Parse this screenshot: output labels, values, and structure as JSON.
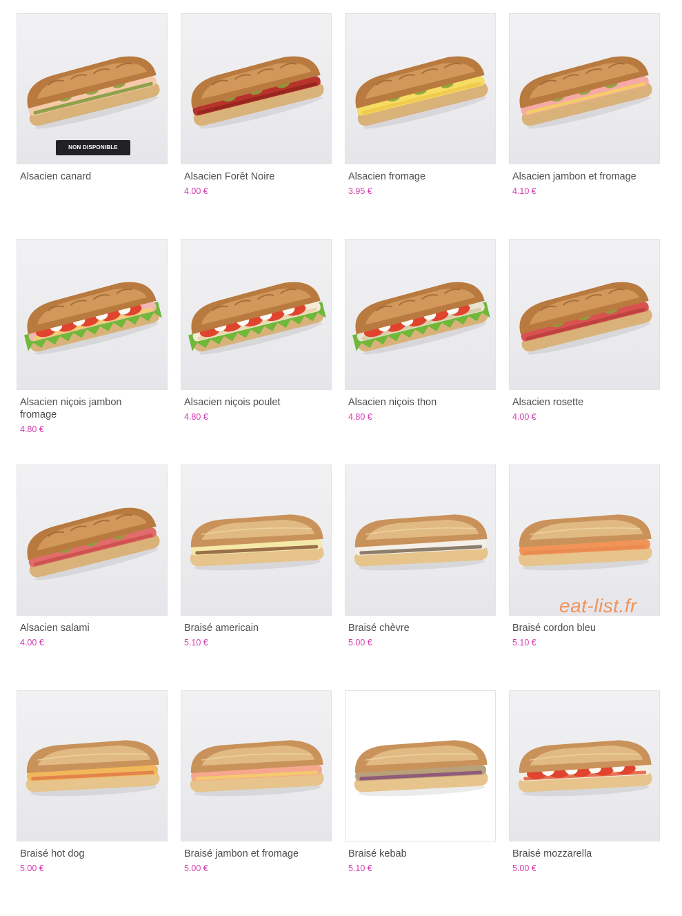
{
  "products": [
    {
      "name": "Alsacien canard",
      "price": "",
      "badge": "NON DISPONIBLE",
      "style": "alsacien",
      "fill": [
        "#f5c9a9",
        "#7d9a3a"
      ],
      "lettuce": false,
      "tomato": false,
      "mozza": false,
      "bg": "grey"
    },
    {
      "name": "Alsacien Forêt Noire",
      "price": "4.00 €",
      "badge": "",
      "style": "alsacien",
      "fill": [
        "#b8322c",
        "#8f241f"
      ],
      "lettuce": false,
      "tomato": false,
      "mozza": false,
      "bg": "grey"
    },
    {
      "name": "Alsacien fromage",
      "price": "3.95 €",
      "badge": "",
      "style": "alsacien",
      "fill": [
        "#f6dc62",
        "#efc84a"
      ],
      "lettuce": false,
      "tomato": false,
      "mozza": false,
      "bg": "grey"
    },
    {
      "name": "Alsacien jambon et fromage",
      "price": "4.10 €",
      "badge": "",
      "style": "alsacien",
      "fill": [
        "#f7a9a6",
        "#f3d35e"
      ],
      "lettuce": false,
      "tomato": false,
      "mozza": false,
      "bg": "grey"
    },
    {
      "name": "Alsacien niçois jambon fromage",
      "price": "4.80 €",
      "badge": "",
      "style": "alsacien",
      "fill": [
        "#f3b6b0",
        "#f1d467"
      ],
      "lettuce": true,
      "tomato": true,
      "mozza": true,
      "bg": "grey"
    },
    {
      "name": "Alsacien niçois poulet",
      "price": "4.80 €",
      "badge": "",
      "style": "alsacien",
      "fill": [
        "#f6ead8",
        "#e8d2a8"
      ],
      "lettuce": true,
      "tomato": true,
      "mozza": true,
      "bg": "grey"
    },
    {
      "name": "Alsacien niçois thon",
      "price": "4.80 €",
      "badge": "",
      "style": "alsacien",
      "fill": [
        "#e9e3d0",
        "#d8c8a0"
      ],
      "lettuce": true,
      "tomato": true,
      "mozza": true,
      "bg": "grey"
    },
    {
      "name": "Alsacien rosette",
      "price": "4.00 €",
      "badge": "",
      "style": "alsacien",
      "fill": [
        "#d9524f",
        "#b8403c"
      ],
      "lettuce": false,
      "tomato": false,
      "mozza": false,
      "bg": "grey"
    },
    {
      "name": "Alsacien salami",
      "price": "4.00 €",
      "badge": "",
      "style": "alsacien",
      "fill": [
        "#e26c6b",
        "#c94d4b"
      ],
      "lettuce": false,
      "tomato": false,
      "mozza": false,
      "bg": "grey"
    },
    {
      "name": "Braisé americain",
      "price": "5.10 €",
      "badge": "",
      "style": "braise",
      "fill": [
        "#f5e9a8",
        "#8a5a3b"
      ],
      "lettuce": false,
      "tomato": false,
      "mozza": false,
      "bg": "grey"
    },
    {
      "name": "Braisé chèvre",
      "price": "5.00 €",
      "badge": "",
      "style": "braise",
      "fill": [
        "#f4f0e8",
        "#7a6a55"
      ],
      "lettuce": false,
      "tomato": false,
      "mozza": false,
      "bg": "grey"
    },
    {
      "name": "Braisé cordon bleu",
      "price": "5.10 €",
      "badge": "",
      "style": "braise",
      "fill": [
        "#f29457",
        "#e88a50"
      ],
      "lettuce": false,
      "tomato": false,
      "mozza": false,
      "bg": "grey"
    },
    {
      "name": "Braisé hot dog",
      "price": "5.00 €",
      "badge": "",
      "style": "braise",
      "fill": [
        "#f2b75a",
        "#e07a4a"
      ],
      "lettuce": false,
      "tomato": false,
      "mozza": false,
      "bg": "grey"
    },
    {
      "name": "Braisé jambon et fromage",
      "price": "5.00 €",
      "badge": "",
      "style": "braise",
      "fill": [
        "#f6a78e",
        "#f3cf6a"
      ],
      "lettuce": false,
      "tomato": false,
      "mozza": false,
      "bg": "grey"
    },
    {
      "name": "Braisé kebab",
      "price": "5.10 €",
      "badge": "",
      "style": "braise",
      "fill": [
        "#b7a07a",
        "#8a4d7a"
      ],
      "lettuce": false,
      "tomato": false,
      "mozza": false,
      "bg": "white"
    },
    {
      "name": "Braisé mozzarella",
      "price": "5.00 €",
      "badge": "",
      "style": "braise",
      "fill": [
        "#f4efe2",
        "#e25a3c"
      ],
      "lettuce": false,
      "tomato": true,
      "mozza": true,
      "bg": "grey"
    }
  ],
  "watermark": "eat-list.fr"
}
